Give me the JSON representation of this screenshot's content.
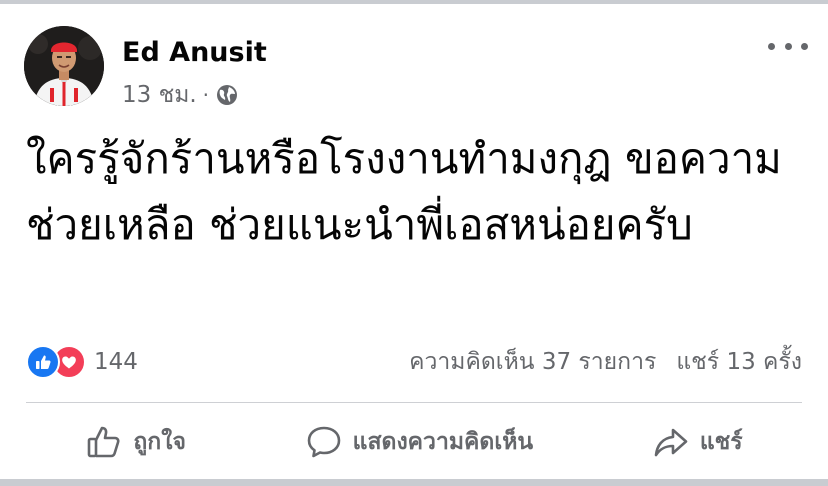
{
  "post": {
    "author": "Ed Anusit",
    "time": "13 ชม.",
    "separator": "·",
    "privacy_icon": "globe-icon",
    "more_icon": "more-options-icon",
    "text": "ใครรู้จักร้านหรือโรงงานทำมงกุฎ ขอความช่วยเหลือ  ช่วยแนะนำพี่เอสหน่อยครับ"
  },
  "engagement": {
    "reaction_icons": [
      "like-reaction-icon",
      "love-reaction-icon"
    ],
    "reaction_count": "144",
    "comments": "ความคิดเห็น 37 รายการ",
    "shares": "แชร์ 13 ครั้ง"
  },
  "actions": {
    "like_label": "ถูกใจ",
    "comment_label": "แสดงความคิดเห็น",
    "share_label": "แชร์"
  },
  "colors": {
    "like_blue": "#1877f2",
    "love_red": "#f33e58",
    "muted_text": "#65676b",
    "divider": "#ced0d4"
  }
}
